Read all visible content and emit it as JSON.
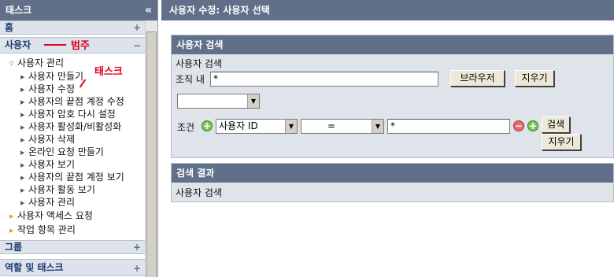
{
  "left": {
    "title": "태스크",
    "collapse": "«",
    "sections": {
      "home": {
        "label": "홈",
        "toggle": "+"
      },
      "user": {
        "label": "사용자",
        "toggle": "−"
      },
      "group": {
        "label": "그룹",
        "toggle": "+"
      },
      "role": {
        "label": "역할 및 태스크",
        "toggle": "+"
      }
    },
    "tree": {
      "user_manage": "사용자 관리",
      "items": [
        "사용자 만들기",
        "사용자 수정",
        "사용자의 끝점 계정 수정",
        "사용자 암호 다시 설정",
        "사용자 활성화/비활성화",
        "사용자 삭제",
        "온라인 요청 만들기",
        "사용자 보기",
        "사용자의 끝점 계정 보기",
        "사용자 활동 보기",
        "사용자 관리"
      ],
      "access_request": "사용자 액세스 요청",
      "work_item": "작업 항목 관리"
    },
    "annotations": {
      "category": "범주",
      "task": "태스크"
    }
  },
  "main": {
    "title": "사용자 수정: 사용자 선택",
    "search": {
      "header": "사용자 검색",
      "label": "사용자 검색",
      "org_label": "조직 내",
      "org_value": "*",
      "browse": "브라우저",
      "clear": "지우기",
      "cond_label": "조건",
      "attr": "사용자 ID",
      "op": "=",
      "value": "*",
      "search": "검색",
      "clear2": "지우기"
    },
    "results": {
      "header": "검색 결과",
      "text": "사용자 검색"
    }
  }
}
